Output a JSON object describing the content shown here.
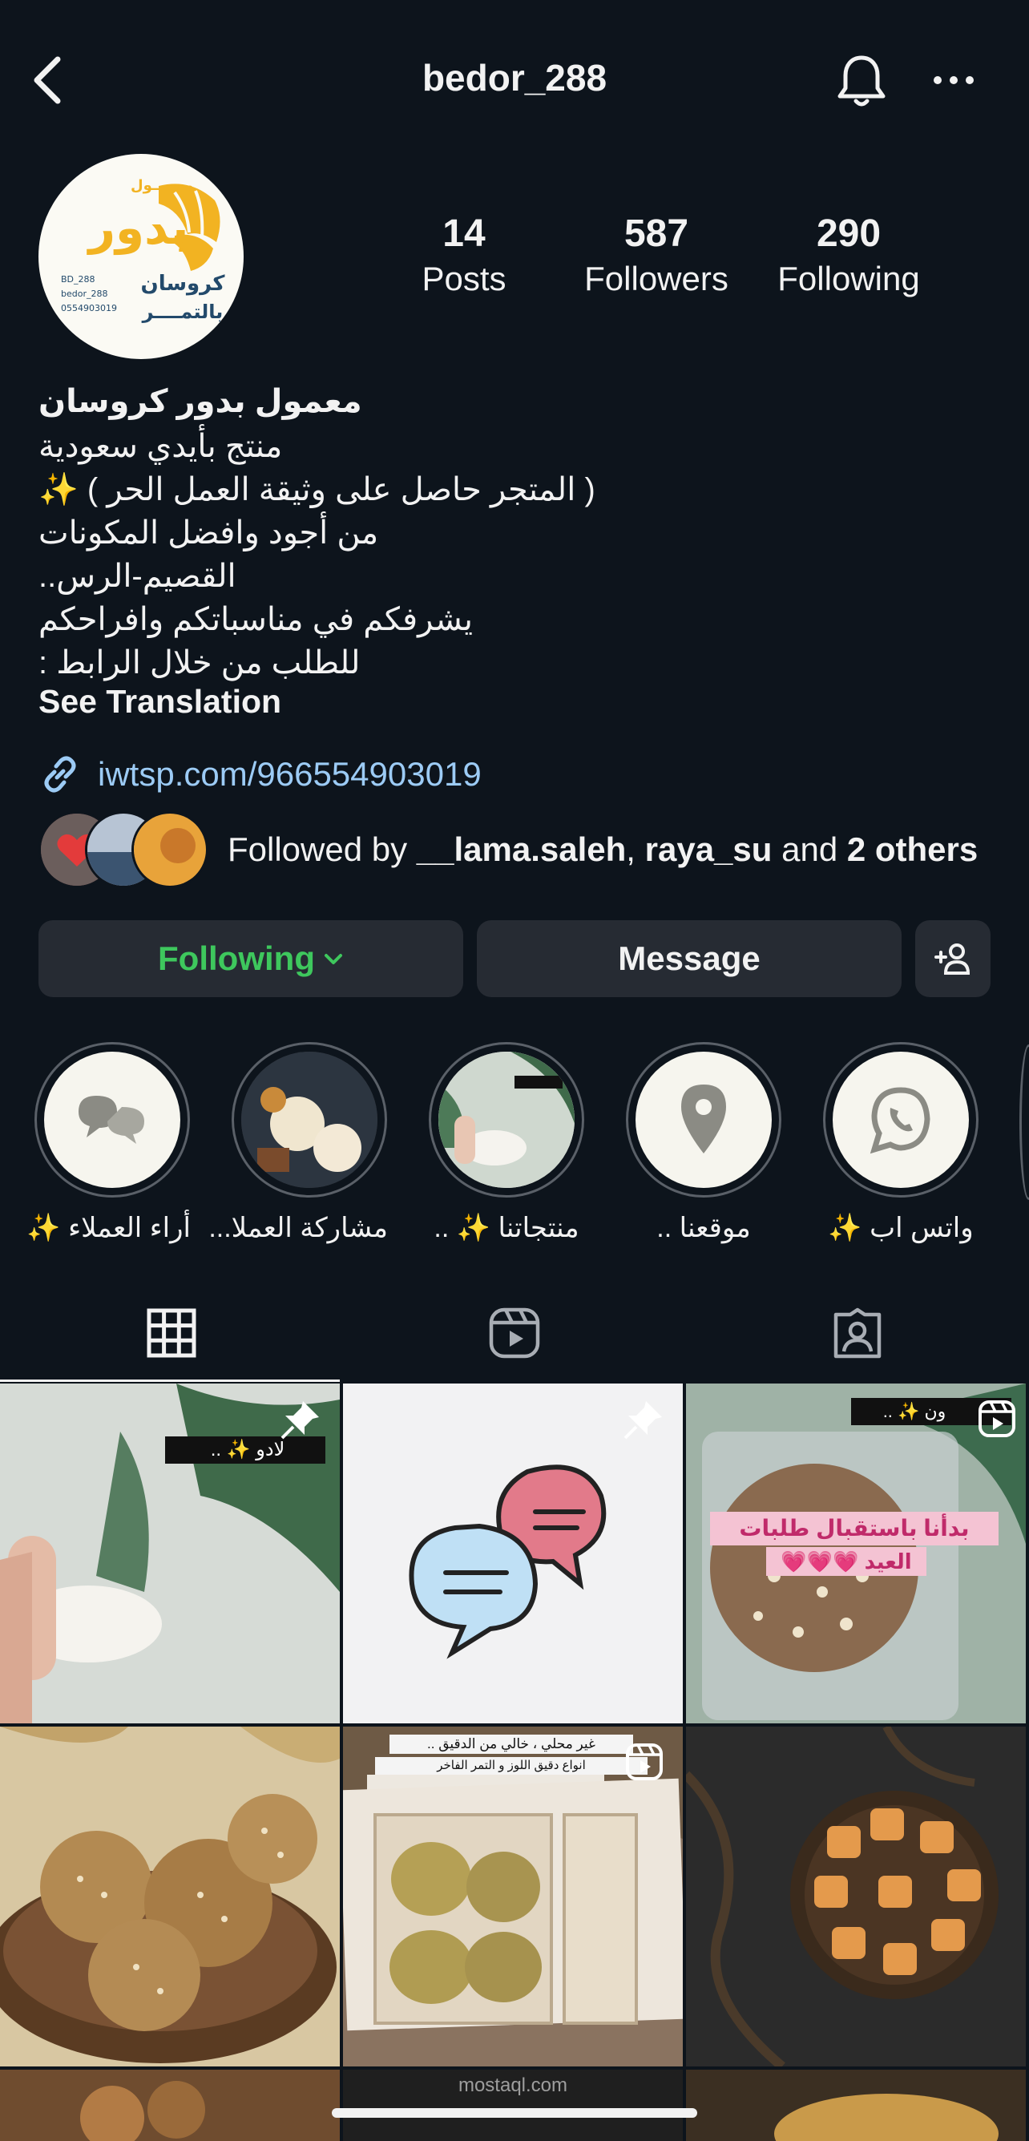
{
  "header": {
    "username": "bedor_288",
    "back_icon": "chevron-left-icon",
    "bell_icon": "bell-icon",
    "more_icon": "more-horizontal-icon"
  },
  "avatar": {
    "brand_text_top": "معمـــول",
    "brand_text_main": "بدور",
    "brand_text_sub1": "كروسان",
    "brand_text_sub2": "بالتمــــر",
    "contact_lines": [
      "BD_288",
      "bedor_288",
      "0554903019"
    ],
    "accent_color": "#f2b322"
  },
  "stats": [
    {
      "value": "14",
      "label": "Posts"
    },
    {
      "value": "587",
      "label": "Followers"
    },
    {
      "value": "290",
      "label": "Following"
    }
  ],
  "bio": {
    "name": "معمول بدور كروسان",
    "lines": [
      "منتج بأيدي سعودية",
      "( المتجر حاصل على وثيقة العمل الحر ) ✨",
      "من أجود وافضل المكونات",
      "القصيم-الرس..",
      "يشرفكم في مناسباتكم وافراحكم",
      "للطلب من خلال الرابط :"
    ],
    "see_translation": "See Translation"
  },
  "link": {
    "url": "iwtsp.com/966554903019",
    "color": "#9ccbf5"
  },
  "followed_by": {
    "prefix": "Followed by ",
    "user1": "__lama.saleh",
    "sep": ", ",
    "user2": "raya_su",
    "mid": " and ",
    "others": "2 others"
  },
  "buttons": {
    "following_label": "Following",
    "message_label": "Message",
    "following_color": "#3ec75d"
  },
  "highlights": [
    {
      "label": "واتس اب ✨",
      "icon": "whatsapp-icon"
    },
    {
      "label": "موقعنا ..",
      "icon": "location-pin-icon"
    },
    {
      "label": "منتجاتنا ✨ ..",
      "icon": "product-photo"
    },
    {
      "label": "مشاركة العملا...",
      "icon": "customer-photo"
    },
    {
      "label": "أراء العملاء ✨",
      "icon": "chat-bubbles-icon"
    }
  ],
  "tabs": [
    {
      "name": "grid",
      "icon": "grid-icon",
      "active": true
    },
    {
      "name": "reels",
      "icon": "reels-icon",
      "active": false
    },
    {
      "name": "tagged",
      "icon": "tagged-user-icon",
      "active": false
    }
  ],
  "posts": {
    "p1_caption": "لادو ✨ ..",
    "p3_caption": "ون ✨ ..",
    "p3_text1": "بدأنا باستقبال طلبات",
    "p3_text2": "العيد 💗💗💗",
    "p5_line1": "غير محلي ، خالي من الدقيق ..",
    "p5_line2": "انواع دقيق اللوز و التمر الفاخر",
    "watermark": "mostaql.com"
  }
}
